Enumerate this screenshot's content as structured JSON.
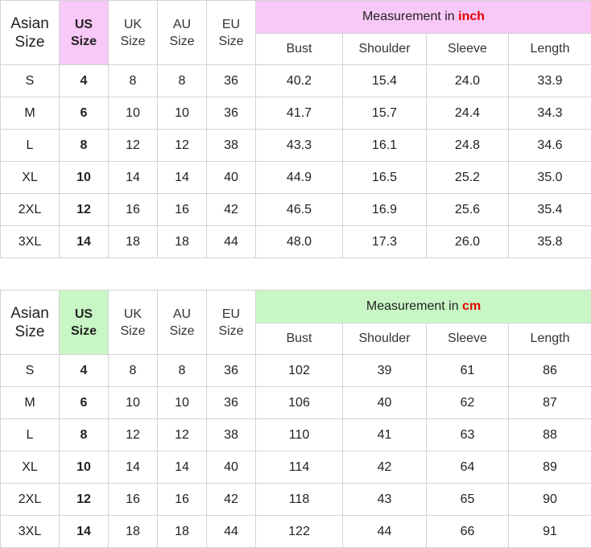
{
  "inch_table": {
    "header": {
      "asian": [
        "Asian",
        "Size"
      ],
      "us": [
        "US",
        "Size"
      ],
      "uk": [
        "UK",
        "Size"
      ],
      "au": [
        "AU",
        "Size"
      ],
      "eu": [
        "EU",
        "Size"
      ],
      "measurement_prefix": "Measurement in ",
      "measurement_unit": "inch",
      "columns": [
        "Bust",
        "Shoulder",
        "Sleeve",
        "Length"
      ]
    },
    "accent_color": "#f8c8f8",
    "rows": [
      [
        "S",
        "4",
        "8",
        "8",
        "36",
        "40.2",
        "15.4",
        "24.0",
        "33.9"
      ],
      [
        "M",
        "6",
        "10",
        "10",
        "36",
        "41.7",
        "15.7",
        "24.4",
        "34.3"
      ],
      [
        "L",
        "8",
        "12",
        "12",
        "38",
        "43.3",
        "16.1",
        "24.8",
        "34.6"
      ],
      [
        "XL",
        "10",
        "14",
        "14",
        "40",
        "44.9",
        "16.5",
        "25.2",
        "35.0"
      ],
      [
        "2XL",
        "12",
        "16",
        "16",
        "42",
        "46.5",
        "16.9",
        "25.6",
        "35.4"
      ],
      [
        "3XL",
        "14",
        "18",
        "18",
        "44",
        "48.0",
        "17.3",
        "26.0",
        "35.8"
      ]
    ]
  },
  "cm_table": {
    "header": {
      "asian": [
        "Asian",
        "Size"
      ],
      "us": [
        "US",
        "Size"
      ],
      "uk": [
        "UK",
        "Size"
      ],
      "au": [
        "AU",
        "Size"
      ],
      "eu": [
        "EU",
        "Size"
      ],
      "measurement_prefix": "Measurement in ",
      "measurement_unit": "cm",
      "columns": [
        "Bust",
        "Shoulder",
        "Sleeve",
        "Length"
      ]
    },
    "accent_color": "#c8f7c5",
    "rows": [
      [
        "S",
        "4",
        "8",
        "8",
        "36",
        "102",
        "39",
        "61",
        "86"
      ],
      [
        "M",
        "6",
        "10",
        "10",
        "36",
        "106",
        "40",
        "62",
        "87"
      ],
      [
        "L",
        "8",
        "12",
        "12",
        "38",
        "110",
        "41",
        "63",
        "88"
      ],
      [
        "XL",
        "10",
        "14",
        "14",
        "40",
        "114",
        "42",
        "64",
        "89"
      ],
      [
        "2XL",
        "12",
        "16",
        "16",
        "42",
        "118",
        "43",
        "65",
        "90"
      ],
      [
        "3XL",
        "14",
        "18",
        "18",
        "44",
        "122",
        "44",
        "66",
        "91"
      ]
    ]
  },
  "unit_color": "#e00000"
}
